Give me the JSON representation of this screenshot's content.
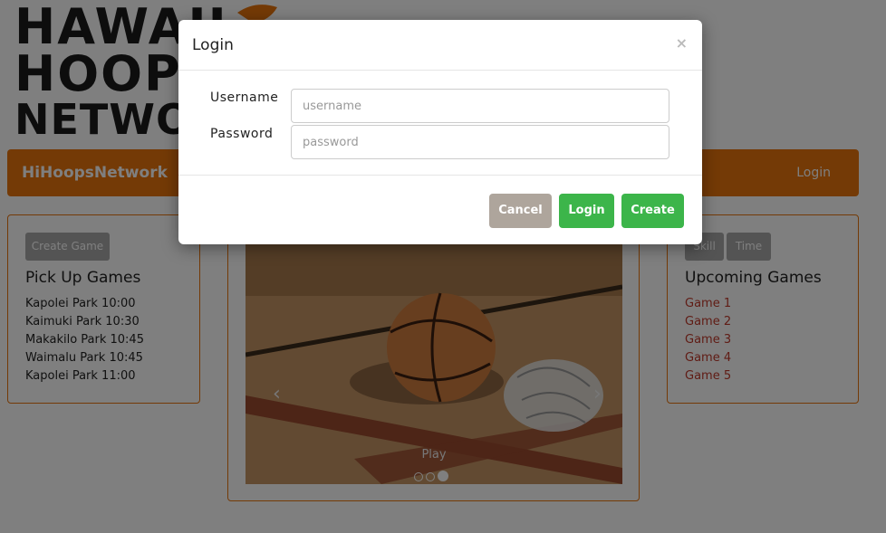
{
  "navbar": {
    "brand": "HiHoopsNetwork",
    "login_link": "Login",
    "color": "#e8740c"
  },
  "pickup": {
    "create_button": "Create Game",
    "title": "Pick Up Games",
    "items": [
      "Kapolei Park 10:00",
      "Kaimuki Park 10:30",
      "Makakilo Park 10:45",
      "Waimalu Park 10:45",
      "Kapolei Park 11:00"
    ]
  },
  "carousel": {
    "caption": "Play",
    "prev": "‹",
    "next": "›"
  },
  "upcoming": {
    "skill_button": "Skill",
    "time_button": "Time",
    "title": "Upcoming Games",
    "items": [
      "Game 1",
      "Game 2",
      "Game 3",
      "Game 4",
      "Game 5"
    ]
  },
  "modal": {
    "title": "Login",
    "close": "×",
    "username_label": "Username",
    "username_placeholder": "username",
    "password_label": "Password",
    "password_placeholder": "password",
    "cancel": "Cancel",
    "login": "Login",
    "create": "Create"
  },
  "colors": {
    "accent": "#e8740c",
    "success": "#3cb54a",
    "cancel": "#aea59c",
    "link": "#c0392b"
  }
}
